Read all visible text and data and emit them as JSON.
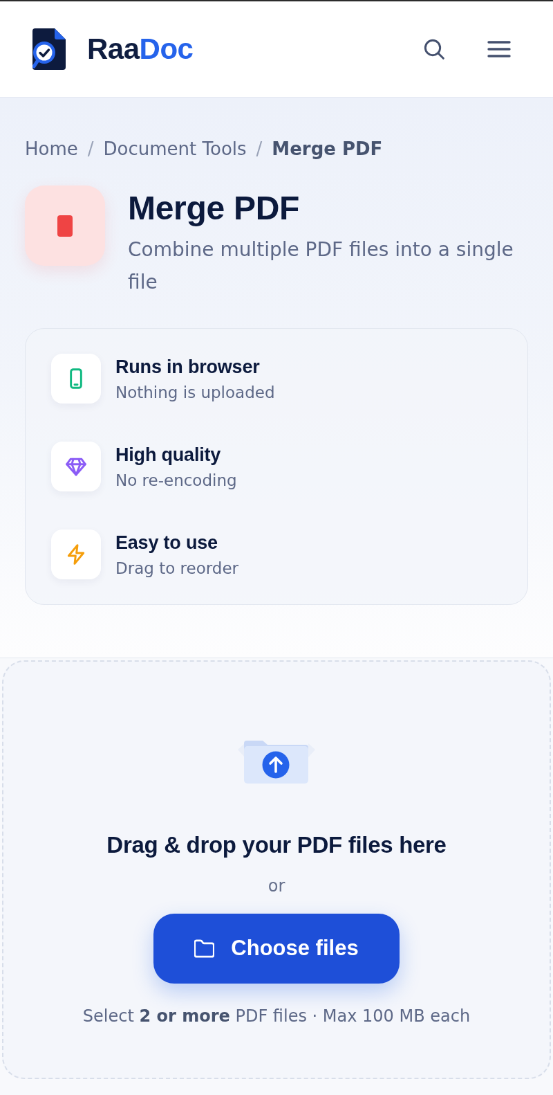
{
  "header": {
    "brand": [
      {
        "text": "Raa",
        "color": "#0f1d40"
      },
      {
        "text": "Doc",
        "color": "#2563eb"
      }
    ]
  },
  "breadcrumb": {
    "separator": "/",
    "items": [
      {
        "label": "Home",
        "current": false
      },
      {
        "label": "Document Tools",
        "current": false
      },
      {
        "label": "Merge PDF",
        "current": true
      }
    ]
  },
  "tool": {
    "title": "Merge PDF",
    "subtitle": "Combine multiple PDF files into a single file"
  },
  "features": [
    {
      "kind": "phone",
      "title": "Runs in browser",
      "subtitle": "Nothing is uploaded",
      "color": "#10b981"
    },
    {
      "kind": "gem",
      "title": "High quality",
      "subtitle": "No re-encoding",
      "color": "#8b5cf6"
    },
    {
      "kind": "bolt",
      "title": "Easy to use",
      "subtitle": "Drag to reorder",
      "color": "#f59e0b"
    }
  ],
  "dropzone": {
    "title": "Drag & drop your PDF files here",
    "divider": "or",
    "button": "Choose files",
    "hint": "Select **2 or more** PDF files · Max 100 MB each"
  }
}
